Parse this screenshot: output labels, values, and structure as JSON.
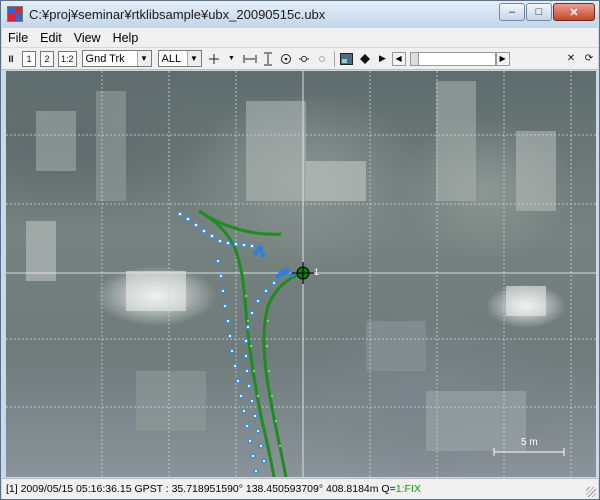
{
  "window": {
    "title": "C:¥proj¥seminar¥rtklibsample¥ubx_20090515c.ubx",
    "controls": {
      "minimize": "–",
      "maximize": "□",
      "close": "✕"
    }
  },
  "menu": {
    "file": "File",
    "edit": "Edit",
    "view": "View",
    "help": "Help"
  },
  "toolbar": {
    "pause": "II",
    "solution_1": "1",
    "solution_2": "2",
    "solution_12": "1:2",
    "plot_type": "Gnd Trk",
    "satellite_filter": "ALL",
    "play": "▶",
    "slider_progress": 0
  },
  "map": {
    "marker_label": "1",
    "scale_label": "5 m",
    "colors": {
      "track_fix": "#1f8c1f",
      "track_float": "#3a8fe0",
      "grid": "#c8cfd0"
    }
  },
  "status": {
    "prefix": "[1] 2009/05/15 05:16:36.15 GPST :  35.718951590°  138.450593709°  408.8184m  Q=",
    "quality": "1:FIX"
  }
}
